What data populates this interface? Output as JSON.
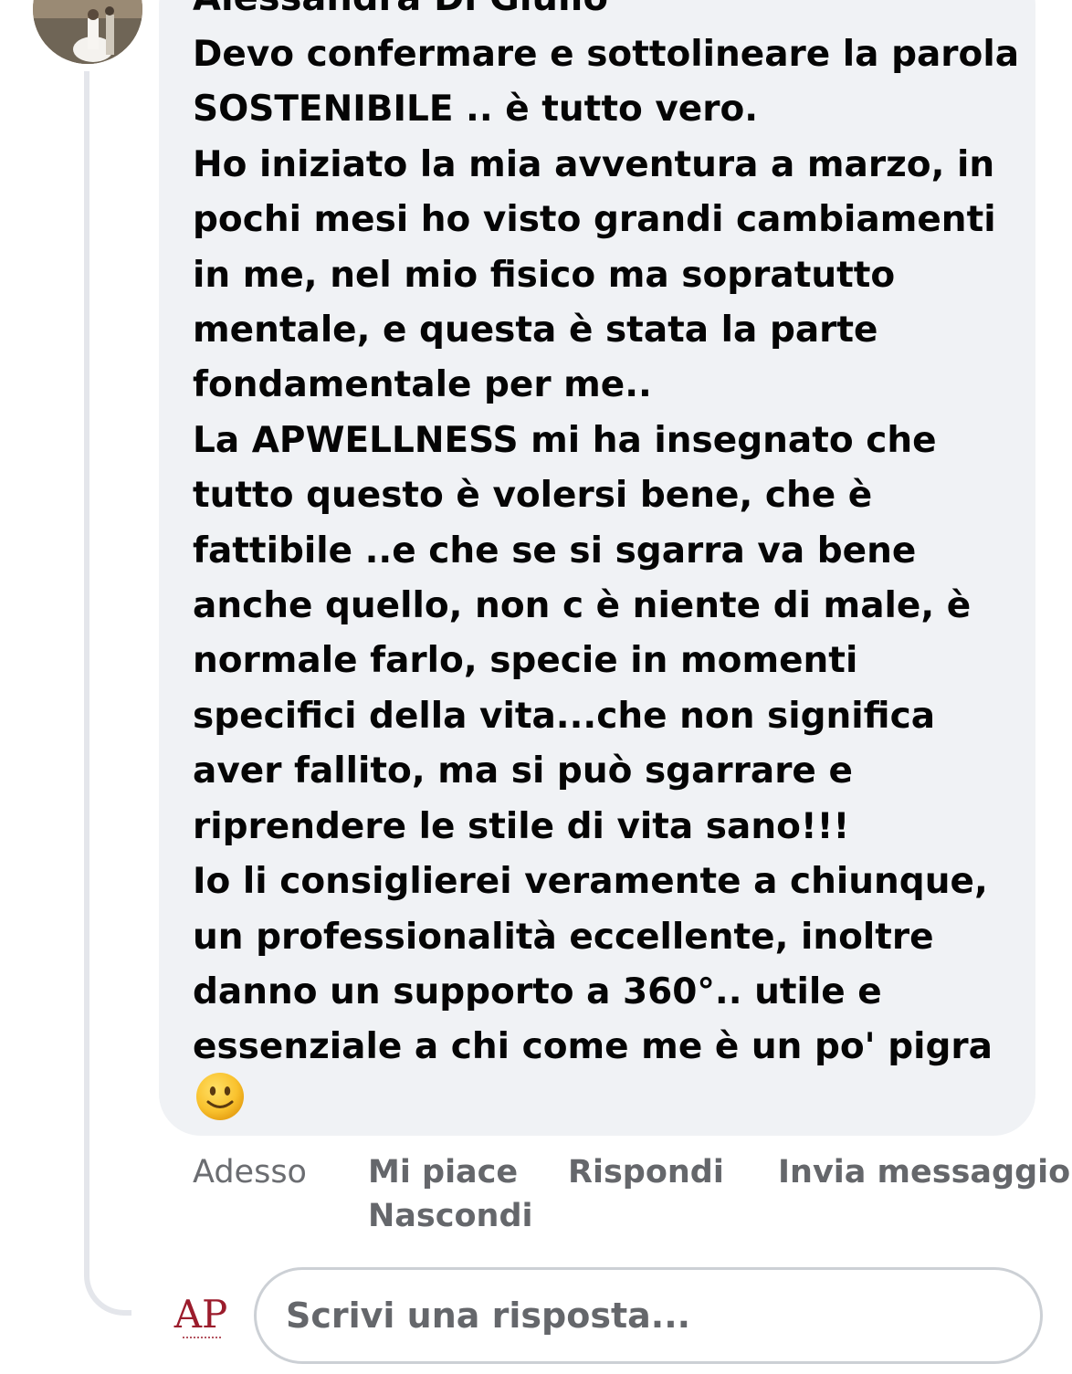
{
  "comment": {
    "author": "Alessandra Di Giulio",
    "lines": [
      "Devo confermare e sottolineare la parola",
      "SOSTENIBILE .. è tutto vero.",
      "Ho iniziato la mia avventura a marzo, in",
      "pochi mesi ho visto grandi cambiamenti",
      "in me, nel mio fisico ma sopratutto",
      "mentale, e questa è stata la parte",
      "fondamentale per me..",
      "La APWELLNESS mi ha insegnato che",
      "tutto questo è volersi bene, che è",
      "fattibile ..e che se si sgarra va bene",
      "anche quello, non c è niente di male, è",
      "normale farlo, specie in momenti",
      "specifici della vita...che non significa",
      "aver fallito, ma si può sgarrare e",
      "riprendere le stile di vita sano!!!",
      "Io li consiglierei veramente a chiunque,",
      "un professionalità eccellente, inoltre",
      "danno un supporto a 360°.. utile e",
      "essenziale a chi come me è un po' pigra"
    ],
    "emoji_icon": "slightly-smiling-face-icon"
  },
  "actions": {
    "time": "Adesso",
    "like": "Mi piace",
    "reply": "Rispondi",
    "message": "Invia messaggio",
    "hide": "Nascondi"
  },
  "reply": {
    "placeholder": "Scrivi una risposta...",
    "logo_letters": "AP",
    "logo_icon": "apwellness-logo-icon"
  },
  "colors": {
    "bubble": "#f0f2f5",
    "text": "#050505",
    "secondary": "#65676b",
    "logo": "#9b1c2c"
  }
}
